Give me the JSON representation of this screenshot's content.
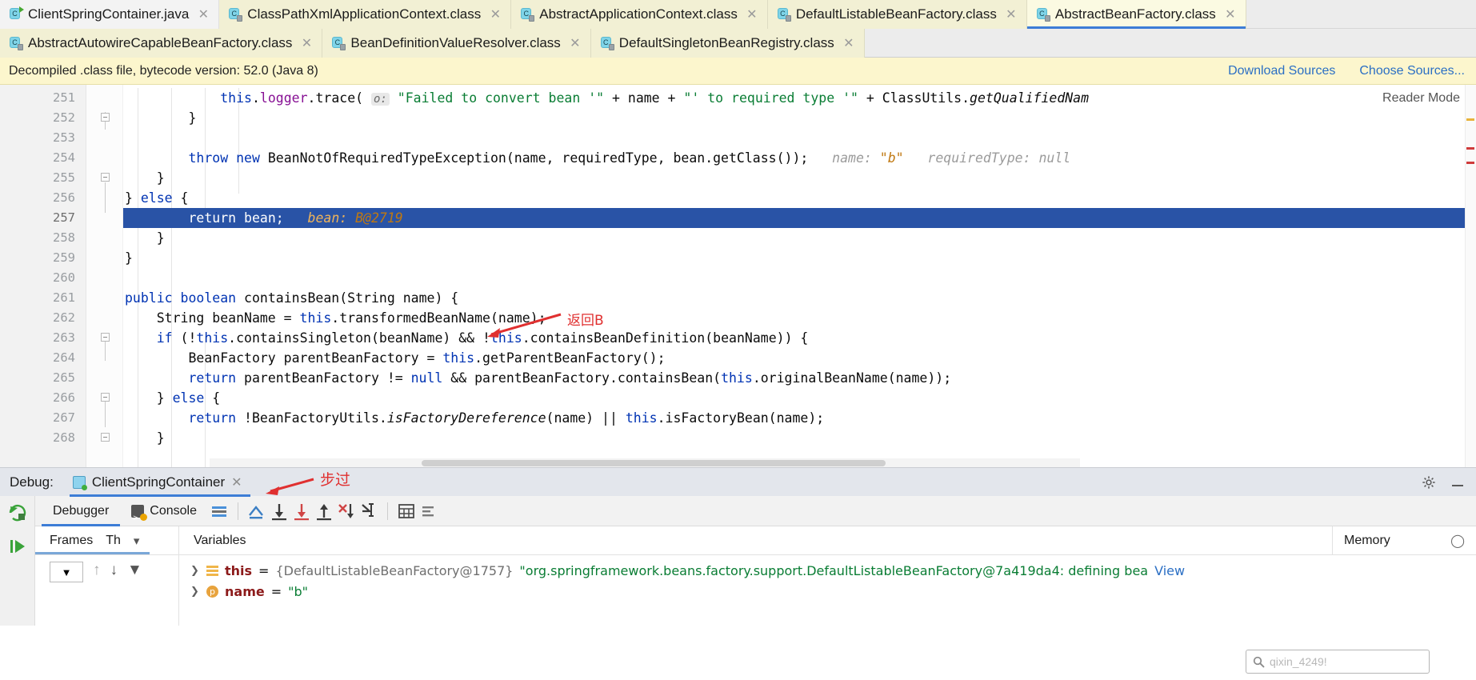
{
  "editor_tabs_row1": [
    {
      "label": "ClientSpringContainer.java",
      "icon": "java-class-run-icon",
      "active": false,
      "style": "plain"
    },
    {
      "label": "ClassPathXmlApplicationContext.class",
      "icon": "class-file-icon",
      "active": false,
      "style": "class"
    },
    {
      "label": "AbstractApplicationContext.class",
      "icon": "class-file-icon",
      "active": false,
      "style": "class"
    },
    {
      "label": "DefaultListableBeanFactory.class",
      "icon": "class-file-icon",
      "active": false,
      "style": "class"
    },
    {
      "label": "AbstractBeanFactory.class",
      "icon": "class-file-icon",
      "active": true,
      "style": "class"
    }
  ],
  "editor_tabs_row2": [
    {
      "label": "AbstractAutowireCapableBeanFactory.class",
      "icon": "class-file-icon"
    },
    {
      "label": "BeanDefinitionValueResolver.class",
      "icon": "class-file-icon"
    },
    {
      "label": "DefaultSingletonBeanRegistry.class",
      "icon": "class-file-icon"
    }
  ],
  "notification": {
    "message": "Decompiled .class file, bytecode version: 52.0 (Java 8)",
    "download_sources": "Download Sources",
    "choose_sources": "Choose Sources..."
  },
  "editor": {
    "reader_mode": "Reader Mode",
    "lines": [
      {
        "num": "251",
        "fold": "none",
        "highlight": false
      },
      {
        "num": "252",
        "fold": "end",
        "highlight": false
      },
      {
        "num": "253",
        "fold": "none",
        "highlight": false
      },
      {
        "num": "254",
        "fold": "none",
        "highlight": false
      },
      {
        "num": "255",
        "fold": "end",
        "highlight": false
      },
      {
        "num": "256",
        "fold": "none",
        "highlight": false
      },
      {
        "num": "257",
        "fold": "none",
        "highlight": true
      },
      {
        "num": "258",
        "fold": "none",
        "highlight": false
      },
      {
        "num": "259",
        "fold": "none",
        "highlight": false
      },
      {
        "num": "260",
        "fold": "none",
        "highlight": false
      },
      {
        "num": "261",
        "fold": "none",
        "highlight": false,
        "run_marker": true
      },
      {
        "num": "262",
        "fold": "none",
        "highlight": false
      },
      {
        "num": "263",
        "fold": "end",
        "highlight": false
      },
      {
        "num": "264",
        "fold": "none",
        "highlight": false
      },
      {
        "num": "265",
        "fold": "none",
        "highlight": false
      },
      {
        "num": "266",
        "fold": "end",
        "highlight": false
      },
      {
        "num": "267",
        "fold": "none",
        "highlight": false
      },
      {
        "num": "268",
        "fold": "end",
        "highlight": false
      }
    ],
    "code_text": {
      "l251_indent": "            ",
      "l251_this": "this",
      "l251_dot1": ".",
      "l251_logger": "logger",
      "l251_dot2": ".",
      "l251_trace": "trace(",
      "l251_hint": "o:",
      "l251_str1": "\"Failed to convert bean '\"",
      "l251_plus1": " + name + ",
      "l251_str2": "\"' to required type '\"",
      "l251_plus2": " + ClassUtils.",
      "l251_meth": "getQualifiedNam",
      "l252": "        }",
      "l254_indent": "        ",
      "l254_throw": "throw new ",
      "l254_rest": "BeanNotOfRequiredTypeException(name, requiredType, bean.getClass());",
      "l254_hint_name": "name:",
      "l254_hint_nameval": "\"b\"",
      "l254_hint_type": "requiredType:",
      "l254_hint_typeval": "null",
      "l255": "    }",
      "l256_close": "} ",
      "l256_else": "else",
      "l256_brace": " {",
      "l257_indent": "        ",
      "l257_return": "return",
      "l257_bean": " bean;",
      "l257_hint": "bean:",
      "l257_hintval": "B@2719",
      "l258": "    }",
      "l259": "}",
      "l261_public": "public",
      "l261_boolean": " boolean",
      "l261_rest": " containsBean(String name) {",
      "l262": "    String beanName = ",
      "l262_this": "this",
      "l262_rest": ".transformedBeanName(name);",
      "l263_if": "    if",
      "l263_a": " (!",
      "l263_this1": "this",
      "l263_b": ".containsSingleton(beanName) && !",
      "l263_this2": "this",
      "l263_c": ".containsBeanDefinition(beanName)) {",
      "l264_a": "        BeanFactory parentBeanFactory = ",
      "l264_this": "this",
      "l264_b": ".getParentBeanFactory();",
      "l265_return": "        return",
      "l265_a": " parentBeanFactory != ",
      "l265_null": "null",
      "l265_b": " && parentBeanFactory.containsBean(",
      "l265_this": "this",
      "l265_c": ".originalBeanName(name));",
      "l266_close": "    } ",
      "l266_else": "else",
      "l266_brace": " {",
      "l267_return": "        return",
      "l267_a": " !BeanFactoryUtils.",
      "l267_meth": "isFactoryDereference",
      "l267_b": "(name) || ",
      "l267_this": "this",
      "l267_c": ".isFactoryBean(name);",
      "l268": "    }"
    },
    "annotation_return_b": "返回B"
  },
  "debug_panel": {
    "title": "Debug:",
    "session_name": "ClientSpringContainer",
    "annotation_step_over": "步过",
    "tabs": [
      {
        "label": "Debugger",
        "selected": true
      },
      {
        "label": "Console",
        "selected": false
      }
    ],
    "toolbar_icons": [
      "show-execution-point-icon",
      "step-over-icon",
      "step-into-icon",
      "force-step-into-icon",
      "step-out-icon",
      "drop-frame-icon",
      "run-to-cursor-icon",
      "evaluate-expression-icon",
      "mute-breakpoints-icon"
    ],
    "rail_icons": [
      "rerun-icon",
      "resume-program-icon"
    ],
    "frames_label": "Frames",
    "threads_label": "Th",
    "variables_label": "Variables",
    "memory_label": "Memory",
    "variables": [
      {
        "icon": "object-list-icon",
        "name": "this",
        "eq": "=",
        "type": "{DefaultListableBeanFactory@1757}",
        "value": "\"org.springframework.beans.factory.support.DefaultListableBeanFactory@7a419da4: defining bea",
        "link": "View"
      },
      {
        "icon": "param-icon",
        "name": "name",
        "eq": "=",
        "type": "",
        "value": "\"b\"",
        "link": ""
      }
    ],
    "search_placeholder": "qixin_4249!"
  },
  "colors": {
    "accent_blue": "#3d7dd6",
    "tab_yellow": "#f2f0d4",
    "notif_yellow": "#fcf6cd",
    "selection_blue": "#2953a6",
    "annotation_red": "#e03030",
    "link_blue": "#2b6fc4"
  }
}
